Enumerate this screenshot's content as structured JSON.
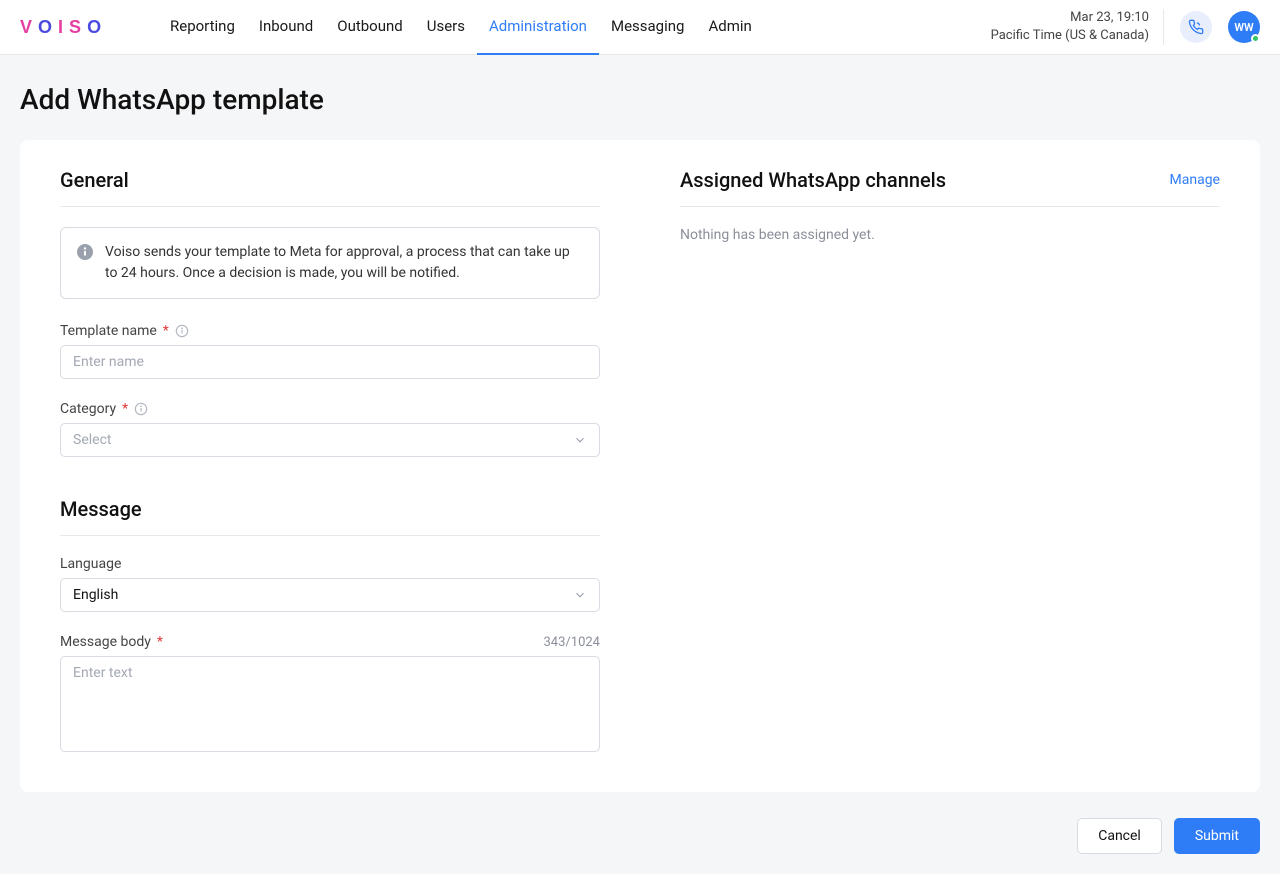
{
  "header": {
    "nav": [
      "Reporting",
      "Inbound",
      "Outbound",
      "Users",
      "Administration",
      "Messaging",
      "Admin"
    ],
    "active_nav": "Administration",
    "datetime": "Mar 23, 19:10",
    "timezone": "Pacific Time (US & Canada)",
    "avatar_initials": "WW"
  },
  "page": {
    "title": "Add WhatsApp template"
  },
  "general": {
    "title": "General",
    "info": "Voiso sends your template to Meta for approval, a process that can take up to 24 hours. Once a decision is made, you will be notified.",
    "template_name": {
      "label": "Template name",
      "required": true,
      "placeholder": "Enter name",
      "value": ""
    },
    "category": {
      "label": "Category",
      "required": true,
      "placeholder": "Select",
      "selected": ""
    }
  },
  "message": {
    "title": "Message",
    "language": {
      "label": "Language",
      "selected": "English"
    },
    "body": {
      "label": "Message body",
      "required": true,
      "placeholder": "Enter text",
      "counter": "343/1024",
      "value": ""
    }
  },
  "assigned": {
    "title": "Assigned WhatsApp channels",
    "manage_label": "Manage",
    "empty_text": "Nothing has been assigned yet."
  },
  "footer": {
    "cancel": "Cancel",
    "submit": "Submit"
  }
}
